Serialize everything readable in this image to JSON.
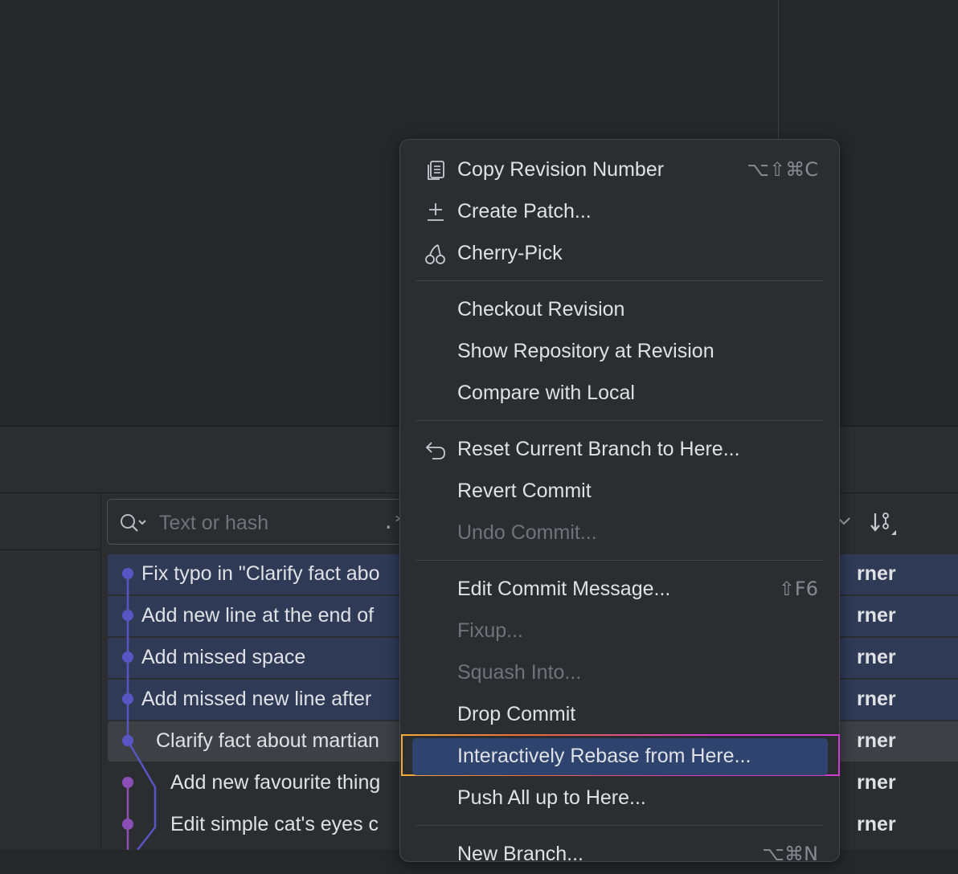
{
  "search": {
    "placeholder": "Text or hash",
    "regex_label": ".*"
  },
  "commits": [
    {
      "message": "Fix typo in \"Clarify fact abo",
      "author": "rner"
    },
    {
      "message": "Add new line at the end of",
      "author": "rner"
    },
    {
      "message": "Add missed space",
      "author": "rner"
    },
    {
      "message": "Add missed new line after",
      "author": "rner"
    },
    {
      "message": "Clarify fact about martian",
      "author": "rner"
    },
    {
      "message": "Add new favourite thing",
      "author": "rner"
    },
    {
      "message": "Edit simple cat's eyes c",
      "author": "rner"
    }
  ],
  "colors": {
    "graph_main": "#5a55c4",
    "graph_branch": "#8c4fb5",
    "selection": "#2e3a56",
    "menu_highlight": "#2e436e"
  },
  "menu": {
    "copy_revision": {
      "label": "Copy Revision Number",
      "shortcut": "⌥⇧⌘C",
      "icon": "copy-icon"
    },
    "create_patch": {
      "label": "Create Patch...",
      "icon": "patch-icon"
    },
    "cherry_pick": {
      "label": "Cherry-Pick",
      "icon": "cherry-icon"
    },
    "checkout_revision": {
      "label": "Checkout Revision"
    },
    "show_repository": {
      "label": "Show Repository at Revision"
    },
    "compare_local": {
      "label": "Compare with Local"
    },
    "reset_branch": {
      "label": "Reset Current Branch to Here...",
      "icon": "undo-arrow-icon"
    },
    "revert_commit": {
      "label": "Revert Commit"
    },
    "undo_commit": {
      "label": "Undo Commit..."
    },
    "edit_message": {
      "label": "Edit Commit Message...",
      "shortcut": "⇧F6"
    },
    "fixup": {
      "label": "Fixup..."
    },
    "squash_into": {
      "label": "Squash Into..."
    },
    "drop_commit": {
      "label": "Drop Commit"
    },
    "interactive_rebase": {
      "label": "Interactively Rebase from Here..."
    },
    "push_all": {
      "label": "Push All up to Here..."
    },
    "new_branch": {
      "label": "New Branch...",
      "shortcut": "⌥⌘N"
    }
  }
}
